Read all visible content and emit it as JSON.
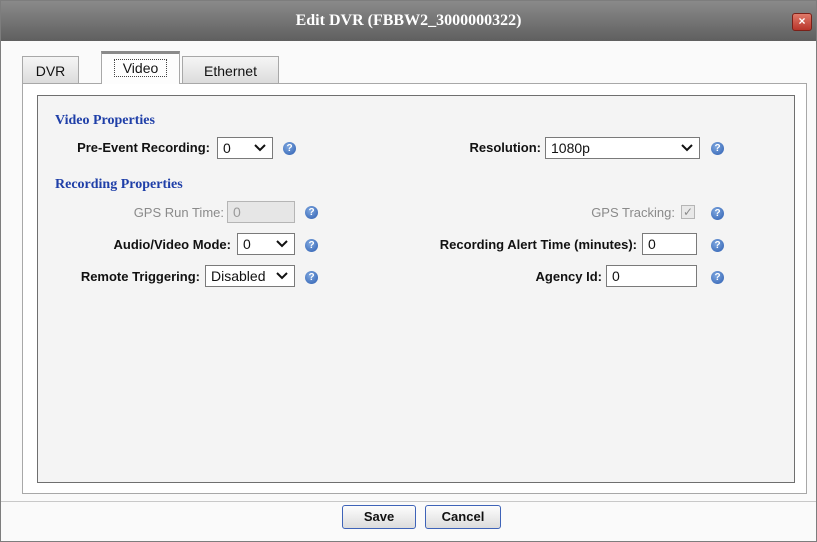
{
  "dialog": {
    "title": "Edit DVR (FBBW2_3000000322)",
    "close_glyph": "×"
  },
  "tabs": [
    {
      "label": "DVR",
      "active": false
    },
    {
      "label": "Video",
      "active": true
    },
    {
      "label": "Ethernet",
      "active": false
    }
  ],
  "video_properties": {
    "heading": "Video Properties",
    "pre_event_label": "Pre-Event Recording:",
    "pre_event_value": "0",
    "resolution_label": "Resolution:",
    "resolution_value": "1080p"
  },
  "recording_properties": {
    "heading": "Recording Properties",
    "gps_run_time_label": "GPS Run Time:",
    "gps_run_time_value": "0",
    "gps_tracking_label": "GPS Tracking:",
    "gps_tracking_checked": true,
    "audio_video_label": "Audio/Video Mode:",
    "audio_video_value": "0",
    "alert_time_label": "Recording Alert Time (minutes):",
    "alert_time_value": "0",
    "remote_triggering_label": "Remote Triggering:",
    "remote_triggering_value": "Disabled",
    "agency_id_label": "Agency Id:",
    "agency_id_value": "0"
  },
  "icons": {
    "help": "?",
    "chevron": "✔",
    "check": "✓"
  },
  "buttons": {
    "save": "Save",
    "cancel": "Cancel"
  },
  "colors": {
    "section_heading": "#1f3fa8",
    "button_border": "#3e63b8",
    "close_button": "#c04434"
  }
}
